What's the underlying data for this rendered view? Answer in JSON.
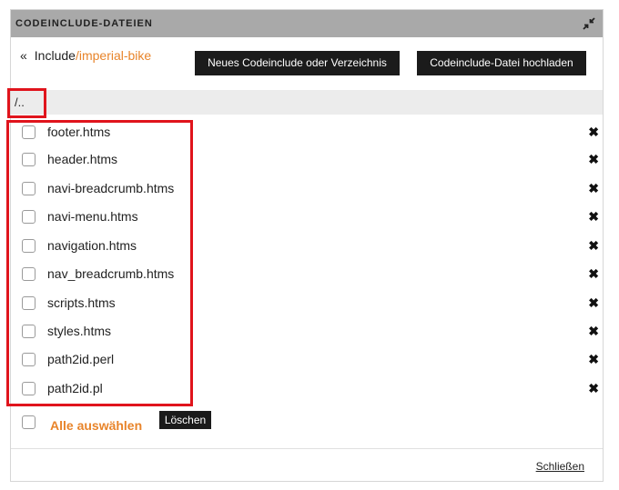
{
  "header": {
    "title": "CODEINCLUDE-DATEIEN",
    "collapse_icon": "collapse-arrows-icon"
  },
  "breadcrumb": {
    "chevron": "«",
    "root": "Include",
    "path": "/imperial-bike"
  },
  "buttons": {
    "new_label": "Neues Codeinclude oder Verzeichnis",
    "upload_label": "Codeinclude-Datei hochladen"
  },
  "parent_dir": "/..",
  "files": [
    {
      "name": "footer.htms"
    },
    {
      "name": "header.htms"
    },
    {
      "name": "navi-breadcrumb.htms"
    },
    {
      "name": "navi-menu.htms"
    },
    {
      "name": "navigation.htms"
    },
    {
      "name": "nav_breadcrumb.htms"
    },
    {
      "name": "scripts.htms"
    },
    {
      "name": "styles.htms"
    },
    {
      "name": "path2id.perl"
    },
    {
      "name": "path2id.pl"
    }
  ],
  "delete_glyph": "✖",
  "select_all_label": "Alle auswählen",
  "delete_label": "Löschen",
  "close_label": "Schließen",
  "colors": {
    "accent": "#e8842a",
    "highlight": "#e0141c",
    "header_bg": "#a9a9a9",
    "button_bg": "#1b1b1b"
  }
}
